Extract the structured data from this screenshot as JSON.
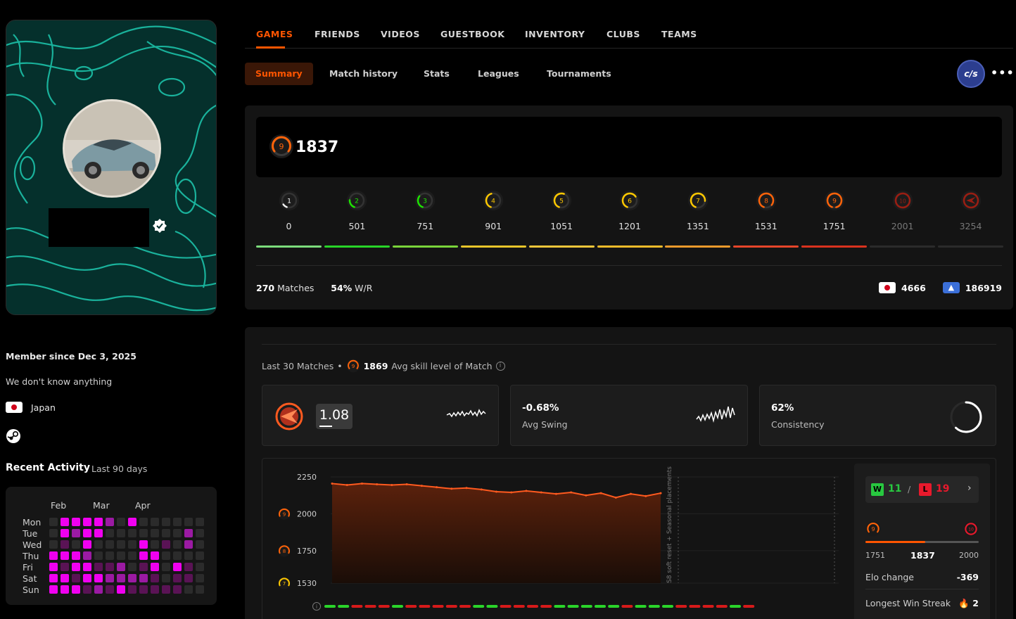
{
  "nav": {
    "tabs": [
      "GAMES",
      "FRIENDS",
      "VIDEOS",
      "GUESTBOOK",
      "INVENTORY",
      "CLUBS",
      "TEAMS"
    ],
    "active_tab": "GAMES"
  },
  "subnav": {
    "tabs": [
      "Summary",
      "Match history",
      "Stats",
      "Leagues",
      "Tournaments"
    ],
    "active": "Summary"
  },
  "game_badge": "c/s",
  "profile": {
    "member_since": "Member since Dec 3, 2025",
    "bio": "We don't know anything",
    "country": "Japan"
  },
  "recent_activity": {
    "title": "Recent Activity",
    "subtitle": "Last 90 days",
    "months": [
      "Feb",
      "Mar",
      "Apr"
    ],
    "days": [
      "Mon",
      "Tue",
      "Wed",
      "Thu",
      "Fri",
      "Sat",
      "Sun"
    ],
    "grid": [
      [
        0,
        3,
        3,
        3,
        3,
        2,
        0,
        3,
        0,
        0,
        0,
        0,
        0,
        0
      ],
      [
        0,
        3,
        2,
        3,
        3,
        0,
        0,
        0,
        0,
        0,
        0,
        0,
        2,
        0
      ],
      [
        0,
        1,
        0,
        3,
        0,
        0,
        0,
        0,
        3,
        0,
        1,
        0,
        2,
        0
      ],
      [
        3,
        3,
        3,
        2,
        0,
        0,
        0,
        0,
        3,
        3,
        0,
        0,
        0,
        0
      ],
      [
        3,
        1,
        3,
        3,
        1,
        1,
        2,
        0,
        1,
        3,
        0,
        3,
        1,
        0
      ],
      [
        3,
        3,
        1,
        3,
        3,
        2,
        2,
        2,
        2,
        1,
        0,
        1,
        1,
        0
      ],
      [
        3,
        3,
        3,
        1,
        2,
        1,
        3,
        1,
        1,
        1,
        1,
        1,
        0,
        0
      ]
    ],
    "colors": [
      "#2b2b2b",
      "#5a1355",
      "#9b1aa3",
      "#f000f0"
    ]
  },
  "level": {
    "current_level": "9",
    "elo": "1837",
    "levels": [
      {
        "n": "1",
        "value": "0",
        "color": "#f2f2f2"
      },
      {
        "n": "2",
        "value": "501",
        "color": "#1ce400"
      },
      {
        "n": "3",
        "value": "751",
        "color": "#1ce400"
      },
      {
        "n": "4",
        "value": "901",
        "color": "#ffc800"
      },
      {
        "n": "5",
        "value": "1051",
        "color": "#ffc800"
      },
      {
        "n": "6",
        "value": "1201",
        "color": "#ffc800"
      },
      {
        "n": "7",
        "value": "1351",
        "color": "#ffc800"
      },
      {
        "n": "8",
        "value": "1531",
        "color": "#ff6309"
      },
      {
        "n": "9",
        "value": "1751",
        "color": "#ff6309"
      },
      {
        "n": "10",
        "value": "2001",
        "color": "#9a1d12"
      },
      {
        "n": "",
        "value": "3254",
        "color": "#9a1d12"
      }
    ],
    "bar_colors": [
      "#7cdc7c",
      "#28d428",
      "#7ad43a",
      "#e8c52a",
      "#f3c63a",
      "#f3bb2a",
      "#ec9a2c",
      "#e6452a",
      "#d9321e",
      "#2b2b2b",
      "#2b2b2b"
    ],
    "matches": "270",
    "matches_label": "Matches",
    "winrate": "54%",
    "winrate_label": "W/R",
    "country_rank": "4666",
    "region_rank": "186919"
  },
  "last30": {
    "label": "Last 30 Matches",
    "avg_skill_level": "9",
    "avg_value": "1869",
    "avg_label": "Avg skill level of Match",
    "kd": "1.08",
    "avg_swing": "-0.68%",
    "avg_swing_label": "Avg Swing",
    "consistency": "62%",
    "consistency_label": "Consistency"
  },
  "chart_data": {
    "type": "area",
    "y_ticks": [
      "2250",
      "2000",
      "1750",
      "1530"
    ],
    "y_tick_levels": [
      "",
      "9",
      "8",
      "7"
    ],
    "ylim": [
      1530,
      2250
    ],
    "values": [
      2205,
      2195,
      2205,
      2200,
      2195,
      2200,
      2190,
      2180,
      2170,
      2175,
      2165,
      2150,
      2145,
      2155,
      2145,
      2135,
      2145,
      2125,
      2140,
      2110,
      2135,
      2120,
      2140
    ],
    "annotation": "S8 soft reset + Seasonal placements",
    "results": [
      1,
      1,
      0,
      0,
      0,
      1,
      0,
      0,
      0,
      0,
      0,
      1,
      1,
      0,
      0,
      0,
      0,
      1,
      1,
      1,
      1,
      1,
      0,
      1,
      1,
      1,
      0,
      0,
      0,
      0,
      1,
      0
    ]
  },
  "summary_side": {
    "wins": "11",
    "losses": "19",
    "w_label": "W",
    "l_label": "L",
    "range_from_level": "9",
    "range_to_level": "10",
    "range_from": "1751",
    "current": "1837",
    "range_to": "2000",
    "elo_change_label": "Elo change",
    "elo_change": "-369",
    "streak_label": "Longest Win Streak",
    "streak": "2"
  }
}
